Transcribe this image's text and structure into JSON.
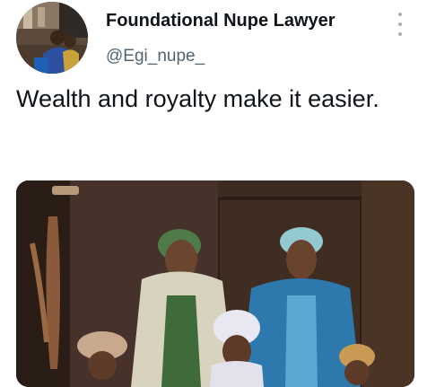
{
  "author": {
    "display_name": "Foundational Nupe Lawyer",
    "handle": "@Egi_nupe_"
  },
  "tweet": {
    "text": "Wealth and royalty make it easier."
  },
  "icons": {
    "more": "more-vertical-icon"
  },
  "colors": {
    "text": "#0f1419",
    "secondary_text": "#536471",
    "icon_gray": "#a8b2bb"
  }
}
